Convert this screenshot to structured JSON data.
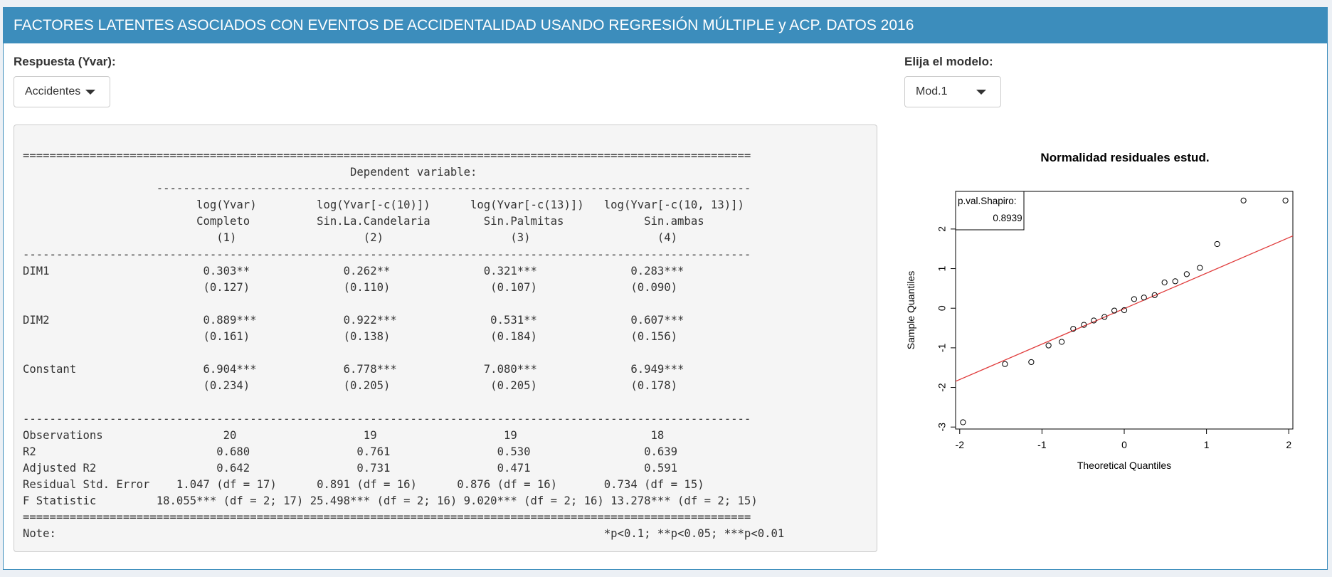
{
  "header": {
    "title": "FACTORES LATENTES ASOCIADOS CON EVENTOS DE ACCIDENTALIDAD USANDO REGRESIÓN MÚLTIPLE y ACP. DATOS 2016"
  },
  "controls": {
    "response_label": "Respuesta (Yvar):",
    "response_value": "Accidentes",
    "model_label": "Elija el modelo:",
    "model_value": "Mod.1"
  },
  "regression_output": {
    "lines": [
      "=============================================================================================================",
      "                                                 Dependent variable:",
      "                    -----------------------------------------------------------------------------------------",
      "                          log(Yvar)         log(Yvar[-c(10)])      log(Yvar[-c(13)])   log(Yvar[-c(10, 13)])",
      "                          Completo          Sin.La.Candelaria        Sin.Palmitas            Sin.ambas",
      "                             (1)                   (2)                   (3)                   (4)",
      "-------------------------------------------------------------------------------------------------------------",
      "DIM1                       0.303**              0.262**              0.321***              0.283***",
      "                           (0.127)              (0.110)               (0.107)              (0.090)",
      "",
      "DIM2                       0.889***             0.922***              0.531**              0.607***",
      "                           (0.161)              (0.138)               (0.184)              (0.156)",
      "",
      "Constant                   6.904***             6.778***             7.080***              6.949***",
      "                           (0.234)              (0.205)               (0.205)              (0.178)",
      "",
      "-------------------------------------------------------------------------------------------------------------",
      "Observations                  20                   19                   19                    18",
      "R2                           0.680                0.761                0.530                 0.639",
      "Adjusted R2                  0.642                0.731                0.471                 0.591",
      "Residual Std. Error    1.047 (df = 17)      0.891 (df = 16)      0.876 (df = 16)       0.734 (df = 15)",
      "F Statistic         18.055*** (df = 2; 17) 25.498*** (df = 2; 16) 9.020*** (df = 2; 16) 13.278*** (df = 2; 15)",
      "=============================================================================================================",
      "Note:                                                                                  *p<0.1; **p<0.05; ***p<0.01"
    ]
  },
  "chart_data": {
    "type": "scatter",
    "title": "Normalidad residuales estud.",
    "xlabel": "Theoretical Quantiles",
    "ylabel": "Sample Quantiles",
    "xlim": [
      -2.05,
      2.05
    ],
    "ylim": [
      -3.05,
      2.95
    ],
    "xticks": [
      -2,
      -1,
      0,
      1,
      2
    ],
    "yticks": [
      -3,
      -2,
      -1,
      0,
      1,
      2
    ],
    "legend": {
      "position": "top-left",
      "label": "p.val.Shapiro:",
      "value": "0.8939"
    },
    "reference_line": {
      "points": [
        [
          -2.2,
          -1.98
        ],
        [
          2.2,
          1.96
        ]
      ],
      "color": "#e03b3b"
    },
    "series": [
      {
        "x": [
          -1.96,
          -1.45,
          -1.13,
          -0.92,
          -0.76,
          -0.62,
          -0.49,
          -0.37,
          -0.24,
          -0.12,
          0.0,
          0.12,
          0.24,
          0.37,
          0.49,
          0.62,
          0.76,
          0.92,
          1.13,
          1.45,
          1.96
        ],
        "y": [
          -2.88,
          -1.41,
          -1.36,
          -0.94,
          -0.85,
          -0.52,
          -0.42,
          -0.31,
          -0.22,
          -0.06,
          -0.05,
          0.23,
          0.27,
          0.33,
          0.65,
          0.68,
          0.86,
          1.02,
          1.62,
          2.72,
          2.72
        ],
        "color": "#000000"
      }
    ]
  }
}
